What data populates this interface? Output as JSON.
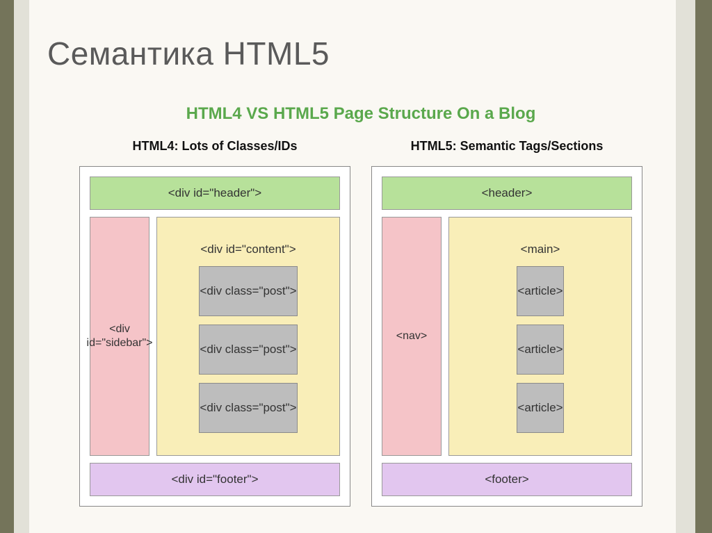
{
  "title": "Семантика HTML5",
  "subtitle": "HTML4 VS HTML5 Page Structure On a Blog",
  "columns": [
    {
      "heading": "HTML4: Lots of Classes/IDs",
      "header_label": "<div id=\"header\">",
      "sidebar_label": "<div id=\"sidebar\">",
      "content_label": "<div id=\"content\">",
      "posts": [
        "<div class=\"post\">",
        "<div class=\"post\">",
        "<div class=\"post\">"
      ],
      "footer_label": "<div id=\"footer\">"
    },
    {
      "heading": "HTML5: Semantic Tags/Sections",
      "header_label": "<header>",
      "sidebar_label": "<nav>",
      "content_label": "<main>",
      "posts": [
        "<article>",
        "<article>",
        "<article>"
      ],
      "footer_label": "<footer>"
    }
  ]
}
